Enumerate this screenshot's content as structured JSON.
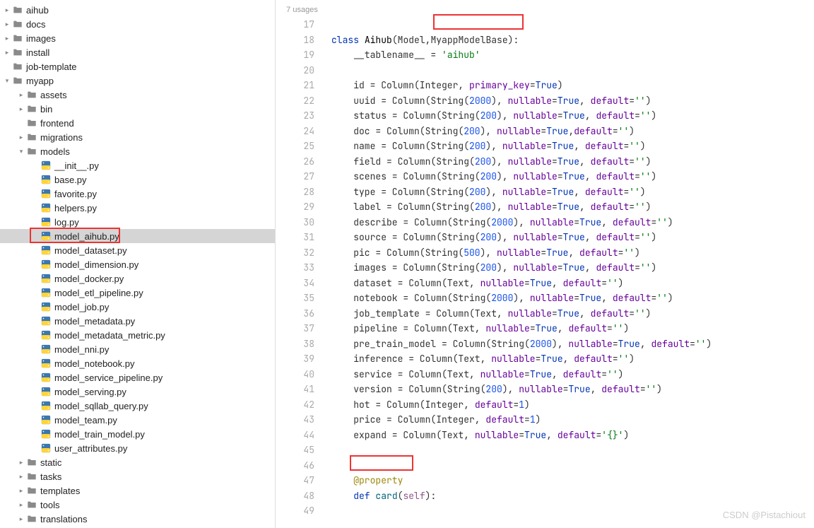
{
  "tree": [
    {
      "depth": 0,
      "chev": "right",
      "type": "folder",
      "label": "aihub"
    },
    {
      "depth": 0,
      "chev": "right",
      "type": "folder",
      "label": "docs"
    },
    {
      "depth": 0,
      "chev": "right",
      "type": "folder",
      "label": "images"
    },
    {
      "depth": 0,
      "chev": "right",
      "type": "folder",
      "label": "install"
    },
    {
      "depth": 0,
      "chev": "none",
      "type": "folder",
      "label": "job-template"
    },
    {
      "depth": 0,
      "chev": "down",
      "type": "folder",
      "label": "myapp"
    },
    {
      "depth": 1,
      "chev": "right",
      "type": "folder",
      "label": "assets"
    },
    {
      "depth": 1,
      "chev": "right",
      "type": "folder",
      "label": "bin"
    },
    {
      "depth": 1,
      "chev": "none",
      "type": "folder",
      "label": "frontend"
    },
    {
      "depth": 1,
      "chev": "right",
      "type": "folder",
      "label": "migrations"
    },
    {
      "depth": 1,
      "chev": "down",
      "type": "folder",
      "label": "models"
    },
    {
      "depth": 2,
      "chev": "none",
      "type": "py",
      "label": "__init__.py"
    },
    {
      "depth": 2,
      "chev": "none",
      "type": "py",
      "label": "base.py"
    },
    {
      "depth": 2,
      "chev": "none",
      "type": "py",
      "label": "favorite.py"
    },
    {
      "depth": 2,
      "chev": "none",
      "type": "py",
      "label": "helpers.py"
    },
    {
      "depth": 2,
      "chev": "none",
      "type": "py",
      "label": "log.py"
    },
    {
      "depth": 2,
      "chev": "none",
      "type": "py",
      "label": "model_aihub.py",
      "selected": true,
      "boxed": true
    },
    {
      "depth": 2,
      "chev": "none",
      "type": "py",
      "label": "model_dataset.py"
    },
    {
      "depth": 2,
      "chev": "none",
      "type": "py",
      "label": "model_dimension.py"
    },
    {
      "depth": 2,
      "chev": "none",
      "type": "py",
      "label": "model_docker.py"
    },
    {
      "depth": 2,
      "chev": "none",
      "type": "py",
      "label": "model_etl_pipeline.py"
    },
    {
      "depth": 2,
      "chev": "none",
      "type": "py",
      "label": "model_job.py"
    },
    {
      "depth": 2,
      "chev": "none",
      "type": "py",
      "label": "model_metadata.py"
    },
    {
      "depth": 2,
      "chev": "none",
      "type": "py",
      "label": "model_metadata_metric.py"
    },
    {
      "depth": 2,
      "chev": "none",
      "type": "py",
      "label": "model_nni.py"
    },
    {
      "depth": 2,
      "chev": "none",
      "type": "py",
      "label": "model_notebook.py"
    },
    {
      "depth": 2,
      "chev": "none",
      "type": "py",
      "label": "model_service_pipeline.py"
    },
    {
      "depth": 2,
      "chev": "none",
      "type": "py",
      "label": "model_serving.py"
    },
    {
      "depth": 2,
      "chev": "none",
      "type": "py",
      "label": "model_sqllab_query.py"
    },
    {
      "depth": 2,
      "chev": "none",
      "type": "py",
      "label": "model_team.py"
    },
    {
      "depth": 2,
      "chev": "none",
      "type": "py",
      "label": "model_train_model.py"
    },
    {
      "depth": 2,
      "chev": "none",
      "type": "py",
      "label": "user_attributes.py"
    },
    {
      "depth": 1,
      "chev": "right",
      "type": "folder",
      "label": "static"
    },
    {
      "depth": 1,
      "chev": "right",
      "type": "folder",
      "label": "tasks"
    },
    {
      "depth": 1,
      "chev": "right",
      "type": "folder",
      "label": "templates"
    },
    {
      "depth": 1,
      "chev": "right",
      "type": "folder",
      "label": "tools"
    },
    {
      "depth": 1,
      "chev": "right",
      "type": "folder",
      "label": "translations"
    }
  ],
  "usages": "7 usages",
  "line_start": 17,
  "line_end": 49,
  "code": {
    "class_kw": "class",
    "class_name": "Aihub",
    "base1": "Model",
    "base2": "MyappModelBase",
    "tablename_attr": "__tablename__",
    "tablename_val": "'aihub'",
    "columns": [
      {
        "name": "id",
        "args": "Integer",
        "kwargs": [
          [
            "primary_key",
            "True"
          ]
        ]
      },
      {
        "name": "uuid",
        "args": "String(2000)",
        "kwargs": [
          [
            "nullable",
            "True"
          ],
          [
            "default",
            "''"
          ]
        ]
      },
      {
        "name": "status",
        "args": "String(200)",
        "kwargs": [
          [
            "nullable",
            "True"
          ],
          [
            "default",
            "''"
          ]
        ]
      },
      {
        "name": "doc",
        "args": "String(200)",
        "kwargs": [
          [
            "nullable",
            "True"
          ],
          [
            "default",
            "''"
          ]
        ],
        "tight": true
      },
      {
        "name": "name",
        "args": "String(200)",
        "kwargs": [
          [
            "nullable",
            "True"
          ],
          [
            "default",
            "''"
          ]
        ]
      },
      {
        "name": "field",
        "args": "String(200)",
        "kwargs": [
          [
            "nullable",
            "True"
          ],
          [
            "default",
            "''"
          ]
        ]
      },
      {
        "name": "scenes",
        "args": "String(200)",
        "kwargs": [
          [
            "nullable",
            "True"
          ],
          [
            "default",
            "''"
          ]
        ]
      },
      {
        "name": "type",
        "args": "String(200)",
        "kwargs": [
          [
            "nullable",
            "True"
          ],
          [
            "default",
            "''"
          ]
        ]
      },
      {
        "name": "label",
        "args": "String(200)",
        "kwargs": [
          [
            "nullable",
            "True"
          ],
          [
            "default",
            "''"
          ]
        ]
      },
      {
        "name": "describe",
        "args": "String(2000)",
        "kwargs": [
          [
            "nullable",
            "True"
          ],
          [
            "default",
            "''"
          ]
        ]
      },
      {
        "name": "source",
        "args": "String(200)",
        "kwargs": [
          [
            "nullable",
            "True"
          ],
          [
            "default",
            "''"
          ]
        ]
      },
      {
        "name": "pic",
        "args": "String(500)",
        "kwargs": [
          [
            "nullable",
            "True"
          ],
          [
            "default",
            "''"
          ]
        ]
      },
      {
        "name": "images",
        "args": "String(200)",
        "kwargs": [
          [
            "nullable",
            "True"
          ],
          [
            "default",
            "''"
          ]
        ]
      },
      {
        "name": "dataset",
        "args": "Text",
        "kwargs": [
          [
            "nullable",
            "True"
          ],
          [
            "default",
            "''"
          ]
        ]
      },
      {
        "name": "notebook",
        "args": "String(2000)",
        "kwargs": [
          [
            "nullable",
            "True"
          ],
          [
            "default",
            "''"
          ]
        ]
      },
      {
        "name": "job_template",
        "args": "Text",
        "kwargs": [
          [
            "nullable",
            "True"
          ],
          [
            "default",
            "''"
          ]
        ]
      },
      {
        "name": "pipeline",
        "args": "Text",
        "kwargs": [
          [
            "nullable",
            "True"
          ],
          [
            "default",
            "''"
          ]
        ]
      },
      {
        "name": "pre_train_model",
        "args": "String(2000)",
        "kwargs": [
          [
            "nullable",
            "True"
          ],
          [
            "default",
            "''"
          ]
        ]
      },
      {
        "name": "inference",
        "args": "Text",
        "kwargs": [
          [
            "nullable",
            "True"
          ],
          [
            "default",
            "''"
          ]
        ]
      },
      {
        "name": "service",
        "args": "Text",
        "kwargs": [
          [
            "nullable",
            "True"
          ],
          [
            "default",
            "''"
          ]
        ]
      },
      {
        "name": "version",
        "args": "String(200)",
        "kwargs": [
          [
            "nullable",
            "True"
          ],
          [
            "default",
            "''"
          ]
        ]
      },
      {
        "name": "hot",
        "args": "Integer",
        "kwargs": [
          [
            "default",
            "1"
          ]
        ]
      },
      {
        "name": "price",
        "args": "Integer",
        "kwargs": [
          [
            "default",
            "1"
          ]
        ]
      },
      {
        "name": "expand",
        "args": "Text",
        "kwargs": [
          [
            "nullable",
            "True"
          ],
          [
            "default",
            "'{}'"
          ]
        ]
      }
    ],
    "decorator": "@property",
    "def_kw": "def",
    "method": "card",
    "self": "self"
  },
  "watermark": "CSDN @Pistachiout"
}
